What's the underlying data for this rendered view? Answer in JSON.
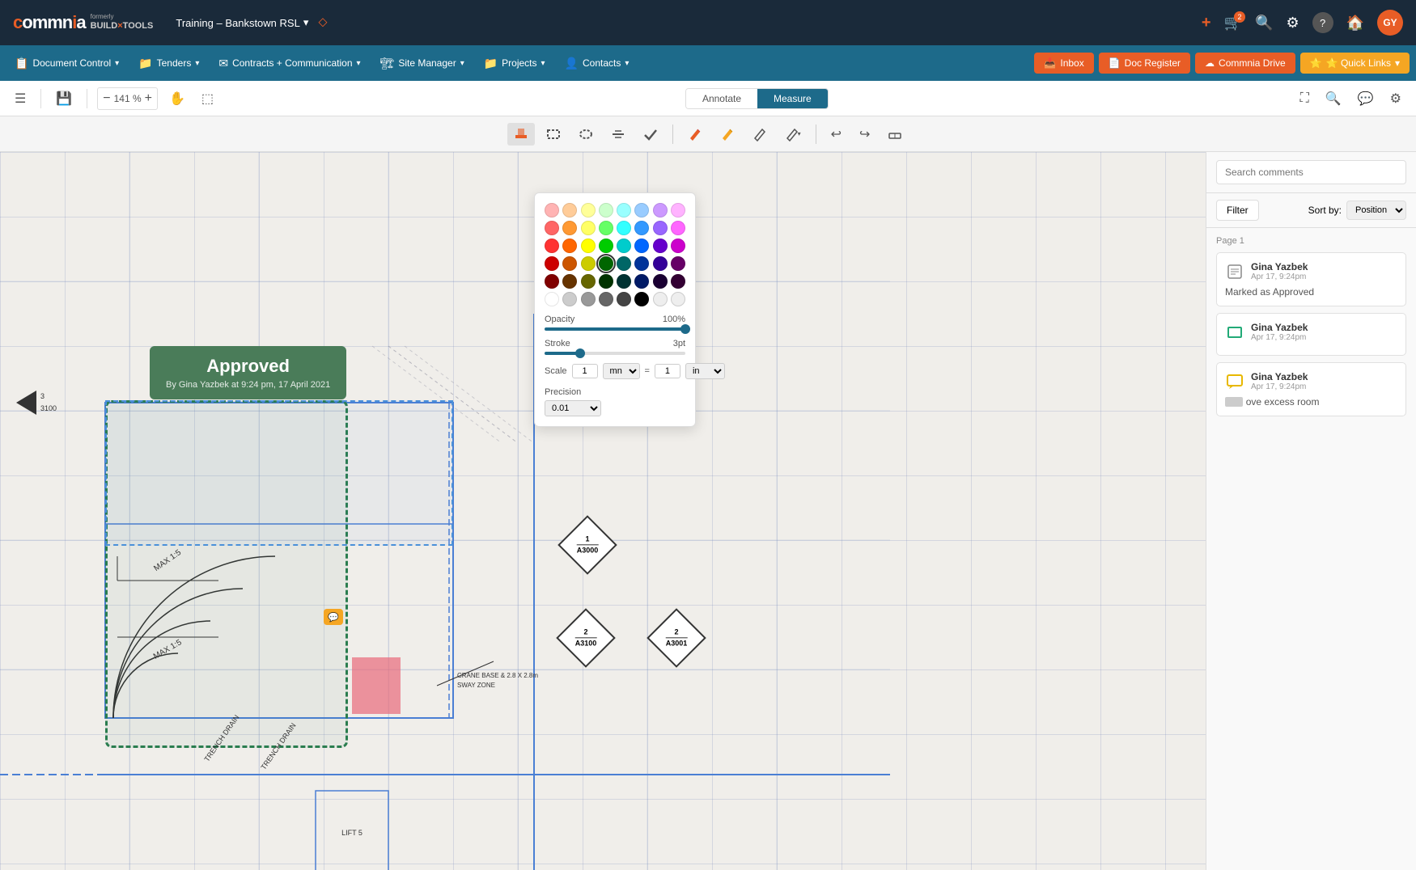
{
  "app": {
    "name": "commnia",
    "formerly": "formerly",
    "buildtools": "BUILD×TOOLS",
    "project": "Training – Bankstown RSL",
    "avatar": "GY"
  },
  "topnav": {
    "icons": {
      "plus": "+",
      "bell": "🔔",
      "bell_badge": "2",
      "search": "🔍",
      "settings": "⚙",
      "help": "?",
      "home": "🏠"
    }
  },
  "secondnav": {
    "items": [
      {
        "label": "Document Control",
        "icon": "📋"
      },
      {
        "label": "Tenders",
        "icon": "📁"
      },
      {
        "label": "Contracts + Communication",
        "icon": "✉"
      },
      {
        "label": "Site Manager",
        "icon": "🏗"
      },
      {
        "label": "Projects",
        "icon": "📁"
      },
      {
        "label": "Contacts",
        "icon": "👤"
      }
    ],
    "buttons": [
      {
        "label": "Inbox"
      },
      {
        "label": "Doc Register"
      },
      {
        "label": "Commnia Drive"
      },
      {
        "label": "⭐ Quick Links"
      }
    ]
  },
  "toolbar": {
    "zoom": "141 %",
    "annotate_tab": "Annotate",
    "measure_tab": "Measure"
  },
  "ann_toolbar": {
    "tools": [
      "highlight",
      "rectangle",
      "ellipse",
      "strikethrough",
      "checkmark",
      "pencil",
      "pencil2",
      "pen",
      "pen_down",
      "undo",
      "redo",
      "erase"
    ]
  },
  "drawing": {
    "approved_text": "Approved",
    "approved_sub": "By Gina Yazbek at 9:24 pm, 17 April 2021",
    "labels": [
      "MAX 1:5",
      "MAX 1:5",
      "TRENCH DRAIN",
      "TRENCH DRAIN",
      "CRANE BASE & 2.8 X 2.8m",
      "SWAY ZONE",
      "LIFT 5"
    ],
    "section_marks": [
      {
        "top": "1",
        "bottom": "A3000"
      },
      {
        "top": "2",
        "bottom": "A3100"
      },
      {
        "top": "2",
        "bottom": "A3001"
      }
    ],
    "arrow_label": "3\n3100"
  },
  "color_picker": {
    "opacity_label": "Opacity",
    "opacity_value": "100%",
    "stroke_label": "Stroke",
    "stroke_value": "3pt",
    "scale_label": "Scale",
    "scale_num1": "1",
    "scale_unit1": "mn",
    "scale_eq": "=",
    "scale_num2": "1",
    "scale_unit2": "in",
    "precision_label": "Precision",
    "precision_value": "0.01",
    "colors": [
      [
        "#ffb3b3",
        "#ffcc99",
        "#ffff99",
        "#ccffcc",
        "#99ffff",
        "#99ccff",
        "#cc99ff",
        "#ffb3ff"
      ],
      [
        "#ff6666",
        "#ff9933",
        "#ffff66",
        "#66ff66",
        "#33ffff",
        "#3399ff",
        "#9966ff",
        "#ff66ff"
      ],
      [
        "#ff3333",
        "#ff6600",
        "#ffff00",
        "#00cc00",
        "#00cccc",
        "#0066ff",
        "#6600cc",
        "#cc00cc"
      ],
      [
        "#cc0000",
        "#cc5500",
        "#cccc00",
        "#006600",
        "#006666",
        "#003399",
        "#330099",
        "#660066"
      ],
      [
        "#800000",
        "#663300",
        "#666600",
        "#003300",
        "#003333",
        "#001a66",
        "#1a0033",
        "#330033"
      ],
      [
        "#ffffff",
        "#cccccc",
        "#999999",
        "#666666",
        "#444444",
        "#000000",
        "transparent",
        "transparent"
      ]
    ],
    "selected_color": "#006600"
  },
  "comments": {
    "search_placeholder": "Search comments",
    "filter_label": "Filter",
    "sort_label": "Sort by:",
    "sort_value": "Position",
    "page_label": "Page 1",
    "items": [
      {
        "author": "Gina Yazbek",
        "time": "Apr 17, 9:24pm",
        "icon": "note",
        "body": "Marked as Approved"
      },
      {
        "author": "Gina Yazbek",
        "time": "Apr 17, 9:24pm",
        "icon": "rectangle",
        "body": ""
      },
      {
        "author": "Gina Yazbek",
        "time": "Apr 17, 9:24pm",
        "icon": "chat",
        "body": "ove excess room",
        "partial": true,
        "prefix": ""
      }
    ]
  }
}
